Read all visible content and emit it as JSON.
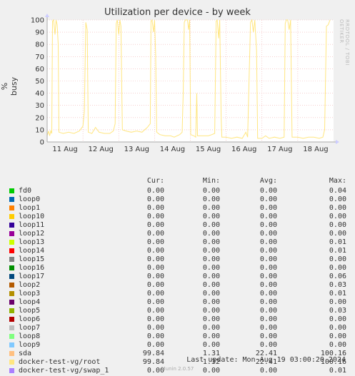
{
  "chart_data": {
    "type": "line",
    "title": "Utilization per device - by week",
    "ylabel": "% busy",
    "side_text": "RRDTOOL / TOBI OETIKER",
    "ylim": [
      0,
      100
    ],
    "yticks": [
      0,
      10,
      20,
      30,
      40,
      50,
      60,
      70,
      80,
      90,
      100
    ],
    "xlim": [
      0,
      8
    ],
    "xticks": [
      {
        "label": "11 Aug",
        "x": 0.5
      },
      {
        "label": "12 Aug",
        "x": 1.5
      },
      {
        "label": "13 Aug",
        "x": 2.5
      },
      {
        "label": "14 Aug",
        "x": 3.5
      },
      {
        "label": "15 Aug",
        "x": 4.5
      },
      {
        "label": "16 Aug",
        "x": 5.5
      },
      {
        "label": "17 Aug",
        "x": 6.5
      },
      {
        "label": "18 Aug",
        "x": 7.5
      }
    ],
    "grid": true,
    "series": [
      {
        "name": "sda",
        "color": "#ffe680",
        "points": [
          [
            0,
            5
          ],
          [
            0.04,
            9
          ],
          [
            0.07,
            5
          ],
          [
            0.1,
            9
          ],
          [
            0.13,
            7
          ],
          [
            0.15,
            99
          ],
          [
            0.18,
            100
          ],
          [
            0.22,
            88
          ],
          [
            0.25,
            100
          ],
          [
            0.28,
            96
          ],
          [
            0.31,
            80
          ],
          [
            0.33,
            8
          ],
          [
            0.45,
            7
          ],
          [
            0.6,
            8
          ],
          [
            0.75,
            7
          ],
          [
            0.9,
            9
          ],
          [
            1.0,
            13
          ],
          [
            1.04,
            25
          ],
          [
            1.08,
            98
          ],
          [
            1.12,
            92
          ],
          [
            1.15,
            8
          ],
          [
            1.25,
            7
          ],
          [
            1.35,
            12
          ],
          [
            1.45,
            8
          ],
          [
            1.6,
            7
          ],
          [
            1.75,
            7
          ],
          [
            1.85,
            9
          ],
          [
            1.9,
            15
          ],
          [
            1.93,
            97
          ],
          [
            1.96,
            100
          ],
          [
            2.0,
            88
          ],
          [
            2.03,
            100
          ],
          [
            2.06,
            95
          ],
          [
            2.1,
            10
          ],
          [
            2.2,
            9
          ],
          [
            2.35,
            8
          ],
          [
            2.5,
            9
          ],
          [
            2.65,
            8
          ],
          [
            2.8,
            12
          ],
          [
            2.88,
            15
          ],
          [
            2.9,
            99
          ],
          [
            2.93,
            100
          ],
          [
            2.97,
            90
          ],
          [
            3.0,
            100
          ],
          [
            3.03,
            72
          ],
          [
            3.06,
            8
          ],
          [
            3.15,
            6
          ],
          [
            3.3,
            5
          ],
          [
            3.45,
            5
          ],
          [
            3.55,
            4
          ],
          [
            3.7,
            6
          ],
          [
            3.77,
            8
          ],
          [
            3.8,
            40
          ],
          [
            3.83,
            98
          ],
          [
            3.86,
            100
          ],
          [
            3.92,
            100
          ],
          [
            3.95,
            92
          ],
          [
            3.98,
            100
          ],
          [
            4.01,
            6
          ],
          [
            4.1,
            5
          ],
          [
            4.15,
            4
          ],
          [
            4.18,
            40
          ],
          [
            4.2,
            5
          ],
          [
            4.35,
            5
          ],
          [
            4.5,
            5
          ],
          [
            4.6,
            6
          ],
          [
            4.68,
            7
          ],
          [
            4.72,
            99
          ],
          [
            4.75,
            100
          ],
          [
            4.79,
            85
          ],
          [
            4.82,
            100
          ],
          [
            4.86,
            20
          ],
          [
            4.88,
            4
          ],
          [
            5.0,
            4
          ],
          [
            5.15,
            3
          ],
          [
            5.3,
            4
          ],
          [
            5.45,
            3
          ],
          [
            5.55,
            8
          ],
          [
            5.6,
            4
          ],
          [
            5.68,
            98
          ],
          [
            5.72,
            100
          ],
          [
            5.76,
            90
          ],
          [
            5.8,
            100
          ],
          [
            5.85,
            75
          ],
          [
            5.88,
            3
          ],
          [
            6.0,
            3
          ],
          [
            6.1,
            5
          ],
          [
            6.2,
            3
          ],
          [
            6.35,
            4
          ],
          [
            6.5,
            3
          ],
          [
            6.62,
            4
          ],
          [
            6.65,
            97
          ],
          [
            6.68,
            100
          ],
          [
            6.72,
            100
          ],
          [
            6.76,
            92
          ],
          [
            6.8,
            100
          ],
          [
            6.84,
            4
          ],
          [
            7.0,
            4
          ],
          [
            7.15,
            3
          ],
          [
            7.3,
            4
          ],
          [
            7.45,
            4
          ],
          [
            7.6,
            3
          ],
          [
            7.7,
            4
          ],
          [
            7.75,
            10
          ],
          [
            7.8,
            95
          ],
          [
            7.85,
            96
          ],
          [
            7.9,
            100
          ]
        ]
      }
    ]
  },
  "legend": {
    "headers": {
      "cur": "Cur:",
      "min": "Min:",
      "avg": "Avg:",
      "max": "Max:"
    },
    "rows": [
      {
        "name": "fd0",
        "color": "#00cc00",
        "cur": "0.00",
        "min": "0.00",
        "avg": "0.00",
        "max": "0.04"
      },
      {
        "name": "loop0",
        "color": "#0066b3",
        "cur": "0.00",
        "min": "0.00",
        "avg": "0.00",
        "max": "0.00"
      },
      {
        "name": "loop1",
        "color": "#ff8000",
        "cur": "0.00",
        "min": "0.00",
        "avg": "0.00",
        "max": "0.00"
      },
      {
        "name": "loop10",
        "color": "#ffcc00",
        "cur": "0.00",
        "min": "0.00",
        "avg": "0.00",
        "max": "0.00"
      },
      {
        "name": "loop11",
        "color": "#330099",
        "cur": "0.00",
        "min": "0.00",
        "avg": "0.00",
        "max": "0.00"
      },
      {
        "name": "loop12",
        "color": "#990099",
        "cur": "0.00",
        "min": "0.00",
        "avg": "0.00",
        "max": "0.00"
      },
      {
        "name": "loop13",
        "color": "#ccff00",
        "cur": "0.00",
        "min": "0.00",
        "avg": "0.00",
        "max": "0.01"
      },
      {
        "name": "loop14",
        "color": "#ff0000",
        "cur": "0.00",
        "min": "0.00",
        "avg": "0.00",
        "max": "0.01"
      },
      {
        "name": "loop15",
        "color": "#808080",
        "cur": "0.00",
        "min": "0.00",
        "avg": "0.00",
        "max": "0.00"
      },
      {
        "name": "loop16",
        "color": "#008f00",
        "cur": "0.00",
        "min": "0.00",
        "avg": "0.00",
        "max": "0.00"
      },
      {
        "name": "loop17",
        "color": "#00487d",
        "cur": "0.00",
        "min": "0.00",
        "avg": "0.00",
        "max": "0.06"
      },
      {
        "name": "loop2",
        "color": "#b35a00",
        "cur": "0.00",
        "min": "0.00",
        "avg": "0.00",
        "max": "0.03"
      },
      {
        "name": "loop3",
        "color": "#b38f00",
        "cur": "0.00",
        "min": "0.00",
        "avg": "0.00",
        "max": "0.01"
      },
      {
        "name": "loop4",
        "color": "#6b006b",
        "cur": "0.00",
        "min": "0.00",
        "avg": "0.00",
        "max": "0.00"
      },
      {
        "name": "loop5",
        "color": "#8fb300",
        "cur": "0.00",
        "min": "0.00",
        "avg": "0.00",
        "max": "0.03"
      },
      {
        "name": "loop6",
        "color": "#b30000",
        "cur": "0.00",
        "min": "0.00",
        "avg": "0.00",
        "max": "0.00"
      },
      {
        "name": "loop7",
        "color": "#bebebe",
        "cur": "0.00",
        "min": "0.00",
        "avg": "0.00",
        "max": "0.00"
      },
      {
        "name": "loop8",
        "color": "#80ff80",
        "cur": "0.00",
        "min": "0.00",
        "avg": "0.00",
        "max": "0.00"
      },
      {
        "name": "loop9",
        "color": "#80c9ff",
        "cur": "0.00",
        "min": "0.00",
        "avg": "0.00",
        "max": "0.00"
      },
      {
        "name": "sda",
        "color": "#ffc080",
        "cur": "99.84",
        "min": "1.31",
        "avg": "22.41",
        "max": "100.16"
      },
      {
        "name": "docker-test-vg/root",
        "color": "#ffe680",
        "cur": "99.84",
        "min": "1.32",
        "avg": "22.41",
        "max": "100.16"
      },
      {
        "name": "docker-test-vg/swap_1",
        "color": "#aa80ff",
        "cur": "0.00",
        "min": "0.00",
        "avg": "0.00",
        "max": "0.01"
      }
    ]
  },
  "footer": {
    "last_update": "Last update: Mon Aug 19 03:00:20 2024",
    "munin_version": "Munin 2.0.57"
  }
}
